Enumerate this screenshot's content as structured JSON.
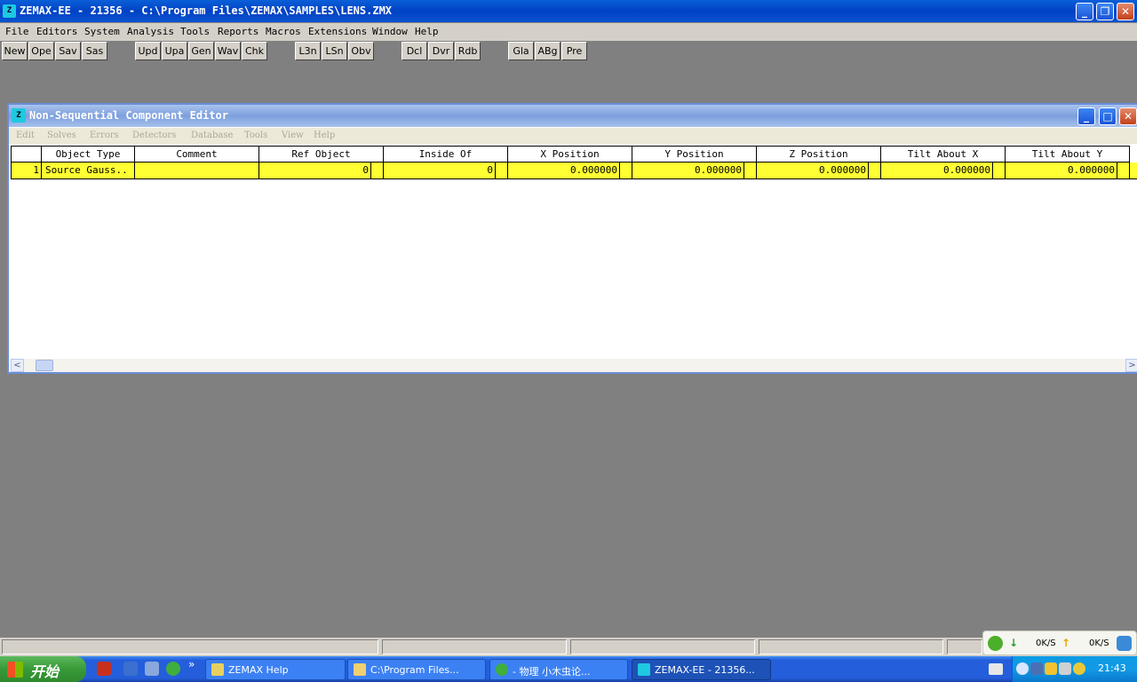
{
  "window": {
    "title": "ZEMAX-EE - 21356 - C:\\Program Files\\ZEMAX\\SAMPLES\\LENS.ZMX",
    "icon": "zemax-app-icon",
    "minimize_glyph": "_",
    "maximize_glyph": "❐",
    "close_glyph": "✕"
  },
  "menu": [
    "File",
    "Editors",
    "System",
    "Analysis",
    "Tools",
    "Reports",
    "Macros",
    "Extensions",
    "Window",
    "Help"
  ],
  "toolbar": [
    "New",
    "Ope",
    "Sav",
    "Sas",
    "Upd",
    "Upa",
    "Gen",
    "Wav",
    "Chk",
    "L3n",
    "LSn",
    "Obv",
    "Dcl",
    "Dvr",
    "Rdb",
    "Gla",
    "ABg",
    "Pre"
  ],
  "editor": {
    "title": "Non-Sequential Component Editor",
    "minimize_glyph": "_",
    "maximize_glyph": "□",
    "close_glyph": "✕",
    "menu": [
      "Edit",
      "Solves",
      "Errors",
      "Detectors",
      "Database",
      "Tools",
      "View",
      "Help"
    ],
    "columns": [
      "Object Type",
      "Comment",
      "Ref Object",
      "Inside Of",
      "X Position",
      "Y Position",
      "Z Position",
      "Tilt About X",
      "Tilt About Y"
    ],
    "rows": [
      {
        "index": "1",
        "object_type": "Source Gauss..",
        "comment": "",
        "ref_object": "0",
        "inside_of": "0",
        "x_position": "0.000000",
        "y_position": "0.000000",
        "z_position": "0.000000",
        "tilt_about_x": "0.000000",
        "tilt_about_y": "0.000000"
      }
    ],
    "scroll_left": "<",
    "scroll_right": ">"
  },
  "netmeter": {
    "down": "0K/S",
    "up": "0K/S"
  },
  "taskbar": {
    "start_label": "开始",
    "tasks": [
      {
        "label": "ZEMAX Help",
        "icon": "help-icon",
        "active": false
      },
      {
        "label": "C:\\Program Files...",
        "icon": "folder-icon",
        "active": false
      },
      {
        "label": "- 物理 小木虫论...",
        "icon": "browser-icon",
        "active": false
      },
      {
        "label": "ZEMAX-EE - 21356...",
        "icon": "zemax-app-icon",
        "active": true
      }
    ],
    "quicklaunch_more": "»",
    "clock": "21:43"
  },
  "colors": {
    "desktop": "#808080",
    "row_highlight": "#ffff33",
    "title_blue": "#0041c4"
  }
}
